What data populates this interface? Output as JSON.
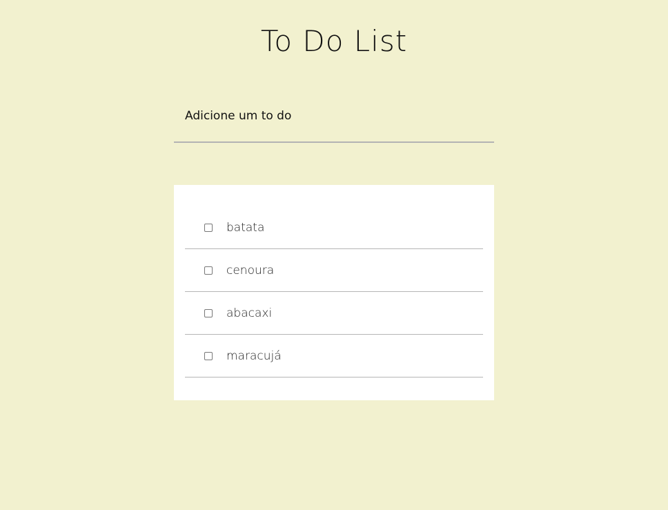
{
  "header": {
    "title": "To Do List"
  },
  "input": {
    "placeholder": "Adicione um to do",
    "value": ""
  },
  "todos": [
    {
      "label": "batata",
      "checked": false
    },
    {
      "label": "cenoura",
      "checked": false
    },
    {
      "label": "abacaxi",
      "checked": false
    },
    {
      "label": "maracujá",
      "checked": false
    }
  ]
}
